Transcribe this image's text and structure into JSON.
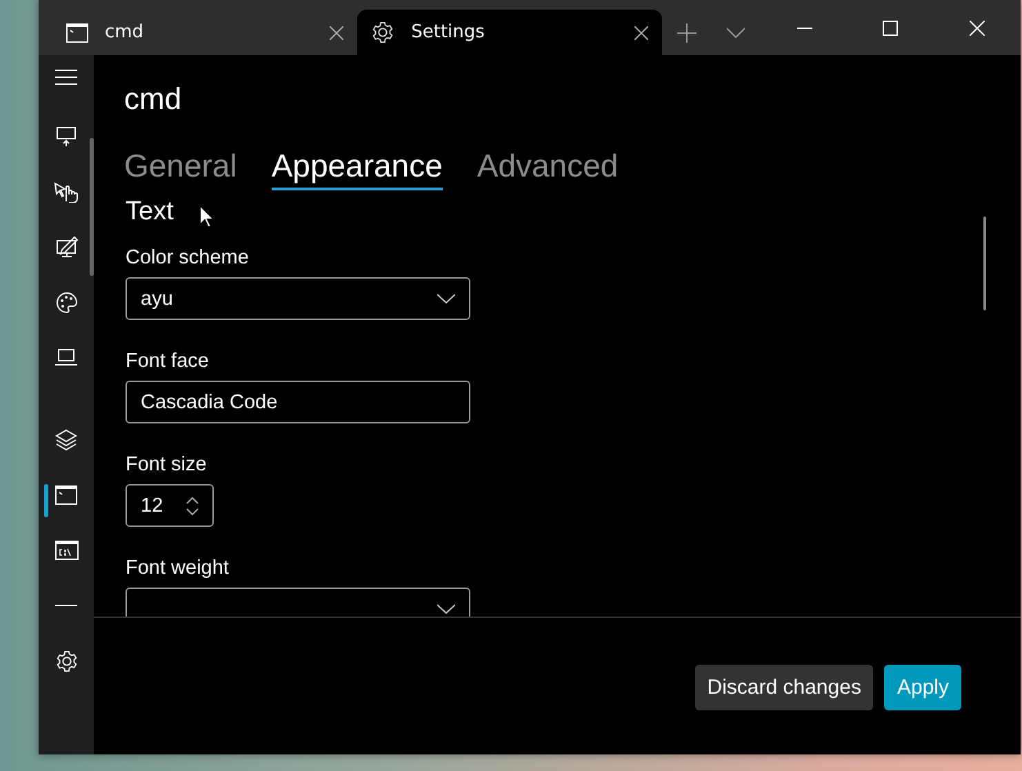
{
  "tabs": [
    {
      "kind": "terminal",
      "title": "cmd",
      "selected": false
    },
    {
      "kind": "gear",
      "title": "Settings",
      "selected": true
    }
  ],
  "sidebar": {
    "items": [
      {
        "kind": "startup",
        "selected": false
      },
      {
        "kind": "interaction",
        "selected": false
      },
      {
        "kind": "rendering",
        "selected": false
      },
      {
        "kind": "palette",
        "selected": false
      },
      {
        "kind": "laptop",
        "selected": false
      },
      {
        "kind": "layers",
        "selected": false
      },
      {
        "kind": "terminal",
        "selected": true
      },
      {
        "kind": "cmd",
        "selected": false
      },
      {
        "kind": "line",
        "selected": false
      }
    ]
  },
  "profile_title": "cmd",
  "pivot": [
    {
      "label": "General",
      "selected": false
    },
    {
      "label": "Appearance",
      "selected": true
    },
    {
      "label": "Advanced",
      "selected": false
    }
  ],
  "section_title": "Text",
  "settings": [
    {
      "kind": "dropdown",
      "label": "Color scheme",
      "value": "ayu"
    },
    {
      "kind": "textbox",
      "label": "Font face",
      "value": "Cascadia Code"
    },
    {
      "kind": "spinner",
      "label": "Font size",
      "value": "12"
    },
    {
      "kind": "dropdown",
      "label": "Font weight"
    }
  ],
  "buttons": [
    {
      "kind": "secondary",
      "label": "Discard changes"
    },
    {
      "kind": "primary",
      "label": "Apply"
    }
  ]
}
